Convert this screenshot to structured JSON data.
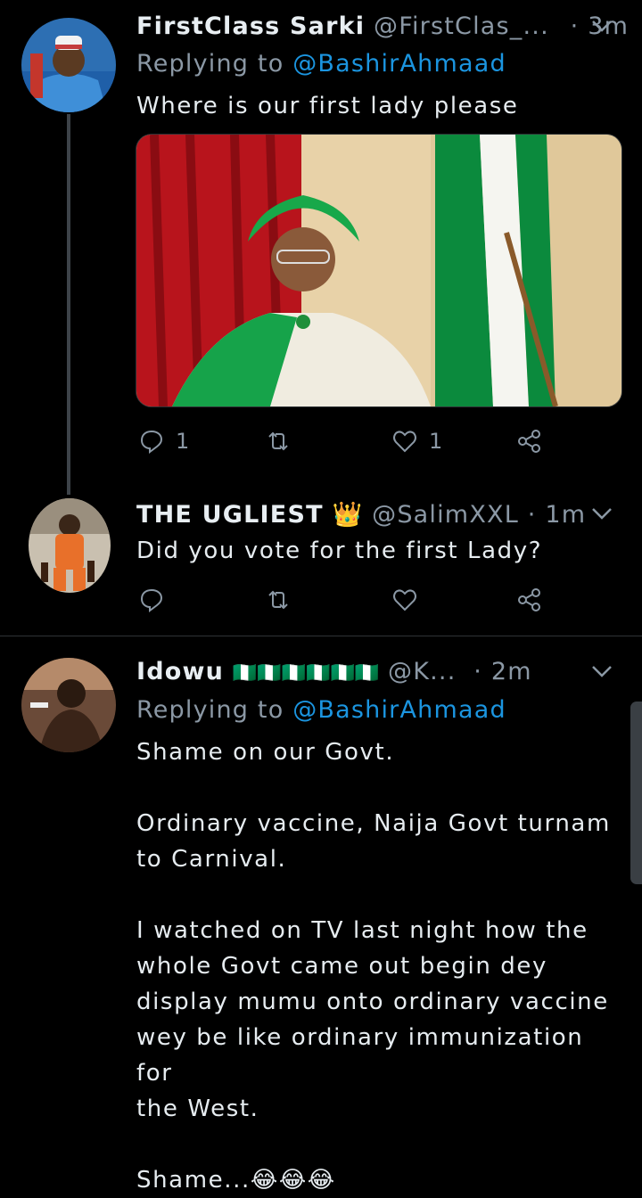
{
  "tweets": [
    {
      "name": "FirstClass Sarki",
      "handle": "@FirstClas_...",
      "time": "· 3m",
      "replying_label": "Replying to",
      "replying_to": "@BashirAhmaad",
      "text": "Where is our first lady please",
      "reply_count": "1",
      "like_count": "1"
    },
    {
      "name": "THE UGLIEST",
      "name_emoji": "👑",
      "handle": "@SalimXXL",
      "time": "· 1m",
      "text": "Did you vote for the first Lady?",
      "reply_count": "",
      "like_count": ""
    },
    {
      "name": "Idowu",
      "name_emoji": "🇳🇬🇳🇬🇳🇬🇳🇬🇳🇬🇳🇬",
      "handle": "@K...",
      "time": "· 2m",
      "replying_label": "Replying to",
      "replying_to": "@BashirAhmaad",
      "text": "Shame on our Govt.\n\nOrdinary vaccine, Naija Govt turnam\nto Carnival.\n\nI watched on TV last night how the\nwhole Govt came out begin dey\ndisplay mumu onto ordinary vaccine\nwey be like ordinary immunization for\nthe West.\n\nShame...",
      "text_emoji": "😂😂😂"
    }
  ],
  "icons": {
    "reply": "reply-icon",
    "retweet": "retweet-icon",
    "like": "heart-icon",
    "share": "share-icon",
    "more": "chevron-down-icon"
  },
  "colors": {
    "background": "#000000",
    "link": "#1b95e0",
    "muted": "#8b98a5",
    "flag_green": "#008751"
  }
}
